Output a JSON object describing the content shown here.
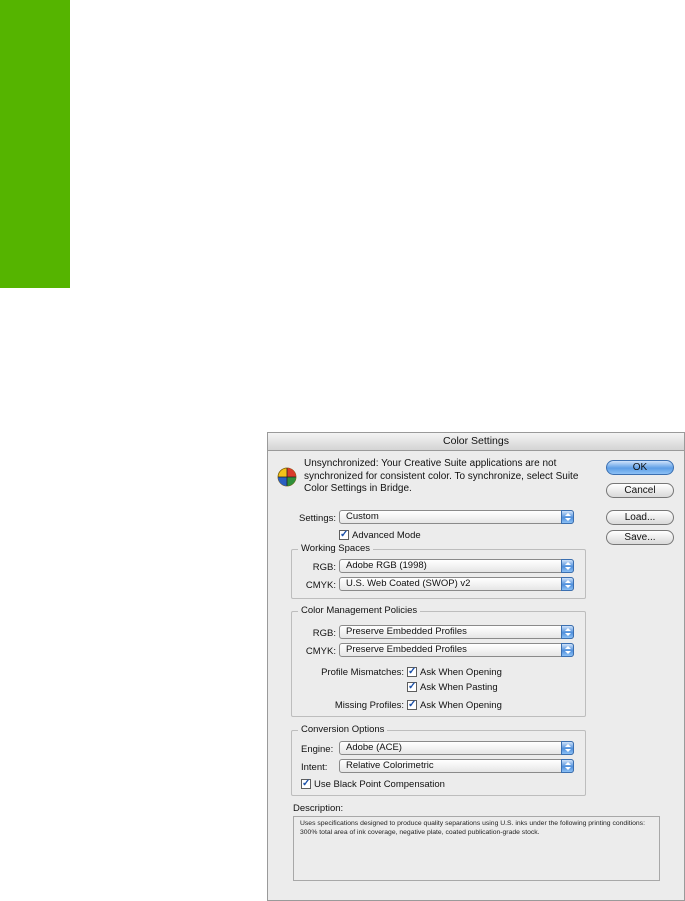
{
  "accent_color": "#55b400",
  "dialog": {
    "title": "Color Settings",
    "message": "Unsynchronized: Your Creative Suite applications are not synchronized for consistent color. To synchronize, select Suite Color Settings in Bridge.",
    "message_icon": "color-sync-icon",
    "buttons": {
      "ok": "OK",
      "cancel": "Cancel",
      "load": "Load...",
      "save": "Save..."
    },
    "settings": {
      "label": "Settings:",
      "value": "Custom"
    },
    "advanced_mode": {
      "label": "Advanced Mode",
      "checked": true
    },
    "working_spaces": {
      "title": "Working Spaces",
      "rgb_label": "RGB:",
      "rgb_value": "Adobe RGB (1998)",
      "cmyk_label": "CMYK:",
      "cmyk_value": "U.S. Web Coated (SWOP) v2"
    },
    "policies": {
      "title": "Color Management Policies",
      "rgb_label": "RGB:",
      "rgb_value": "Preserve Embedded Profiles",
      "cmyk_label": "CMYK:",
      "cmyk_value": "Preserve Embedded Profiles",
      "mismatch_label": "Profile Mismatches:",
      "ask_opening": "Ask When Opening",
      "ask_pasting": "Ask When Pasting",
      "missing_label": "Missing Profiles:",
      "missing_ask_opening": "Ask When Opening"
    },
    "conversion": {
      "title": "Conversion Options",
      "engine_label": "Engine:",
      "engine_value": "Adobe (ACE)",
      "intent_label": "Intent:",
      "intent_value": "Relative Colorimetric",
      "bpc_label": "Use Black Point Compensation"
    },
    "description": {
      "label": "Description:",
      "text": "Uses specifications designed to produce quality separations using U.S. inks under the following printing conditions: 300% total area of ink coverage, negative plate, coated publication-grade stock."
    }
  }
}
